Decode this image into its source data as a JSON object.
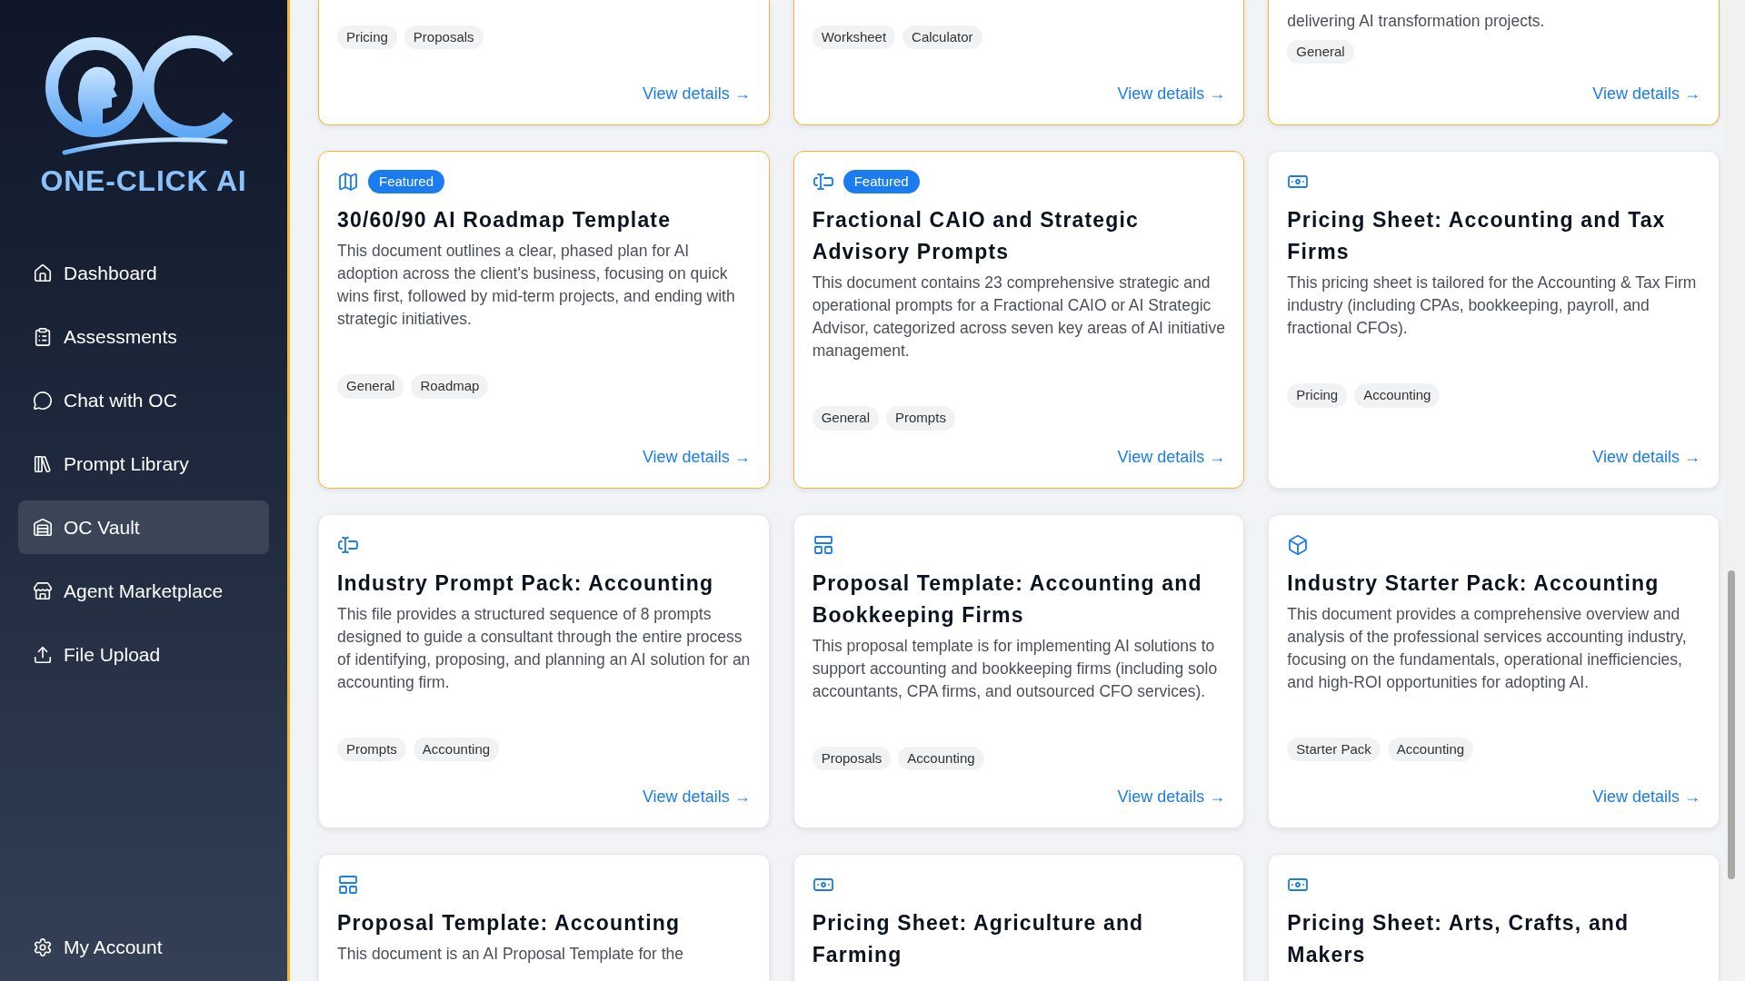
{
  "sidebar": {
    "brand": "ONE-CLICK AI",
    "items": [
      {
        "kind": "home",
        "label": "Dashboard",
        "selected": false
      },
      {
        "kind": "clipboard",
        "label": "Assessments",
        "selected": false
      },
      {
        "kind": "chat",
        "label": "Chat with OC",
        "selected": false
      },
      {
        "kind": "library",
        "label": "Prompt Library",
        "selected": false
      },
      {
        "kind": "vault",
        "label": "OC Vault",
        "selected": true
      },
      {
        "kind": "store",
        "label": "Agent Marketplace",
        "selected": false
      },
      {
        "kind": "upload",
        "label": "File Upload",
        "selected": false
      }
    ],
    "footer_item": {
      "kind": "settings",
      "label": "My Account"
    }
  },
  "cut_cards": [
    {
      "highlighted": true,
      "tags": [
        "Pricing",
        "Proposals"
      ],
      "link": "View details →"
    },
    {
      "highlighted": true,
      "tags": [
        "Worksheet",
        "Calculator"
      ],
      "link": "View details →"
    },
    {
      "highlighted": true,
      "description": "delivering AI transformation projects.",
      "tags": [
        "General"
      ],
      "link": "View details →"
    }
  ],
  "cards": [
    {
      "kind": "map",
      "badge": "Featured",
      "highlighted": true,
      "title": "30/60/90 AI Roadmap Template",
      "description": "This document outlines a clear, phased plan for AI adoption across the client's business, focusing on quick wins first, followed by mid-term projects, and ending with strategic initiatives.",
      "tags": [
        "General",
        "Roadmap"
      ],
      "link": "View details →"
    },
    {
      "kind": "cursor",
      "badge": "Featured",
      "highlighted": true,
      "title": "Fractional CAIO and Strategic Advisory Prompts",
      "description": "This document contains 23 comprehensive strategic and operational prompts for a Fractional CAIO or AI Strategic Advisor, categorized across seven key areas of AI initiative management.",
      "tags": [
        "General",
        "Prompts"
      ],
      "link": "View details →"
    },
    {
      "kind": "money",
      "highlighted": false,
      "title": "Pricing Sheet: Accounting and Tax Firms",
      "description": "This pricing sheet is tailored for the Accounting & Tax Firm industry (including CPAs, bookkeeping, payroll, and fractional CFOs).",
      "tags": [
        "Pricing",
        "Accounting"
      ],
      "link": "View details →"
    },
    {
      "kind": "cursor",
      "highlighted": false,
      "title": "Industry Prompt Pack: Accounting",
      "description": "This file provides a structured sequence of 8 prompts designed to guide a consultant through the entire process of identifying, proposing, and planning an AI solution for an accounting firm.",
      "tags": [
        "Prompts",
        "Accounting"
      ],
      "link": "View details →"
    },
    {
      "kind": "layout",
      "highlighted": false,
      "title": "Proposal Template: Accounting and Bookkeeping Firms",
      "description": "This proposal template is for implementing AI solutions to support accounting and bookkeeping firms (including solo accountants, CPA firms, and outsourced CFO services).",
      "tags": [
        "Proposals",
        "Accounting"
      ],
      "link": "View details →"
    },
    {
      "kind": "box",
      "highlighted": false,
      "title": "Industry Starter Pack: Accounting",
      "description": "This document provides a comprehensive overview and analysis of the professional services accounting industry, focusing on the fundamentals, operational inefficiencies, and high-ROI opportunities for adopting AI.",
      "tags": [
        "Starter Pack",
        "Accounting"
      ],
      "link": "View details →"
    },
    {
      "kind": "layout",
      "highlighted": false,
      "title": "Proposal Template: Accounting",
      "description": "This document is an AI Proposal Template for the"
    },
    {
      "kind": "money",
      "highlighted": false,
      "title": "Pricing Sheet: Agriculture and Farming"
    },
    {
      "kind": "money",
      "highlighted": false,
      "title": "Pricing Sheet: Arts, Crafts, and Makers"
    }
  ]
}
